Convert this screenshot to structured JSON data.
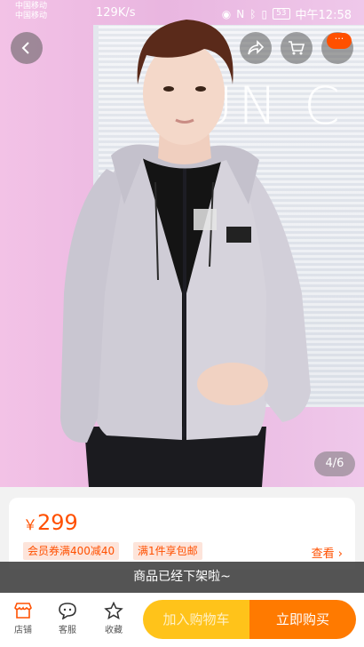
{
  "status_bar": {
    "carrier_1": "中国移动",
    "carrier_2": "中国移动",
    "speed": "129K/s",
    "battery": "53",
    "time": "中午12:58"
  },
  "gallery": {
    "page_indicator": "4/6"
  },
  "product": {
    "currency": "￥",
    "price": "299",
    "coupon_tag": "会员券满400减40",
    "shipping_tag": "满1件享包邮",
    "view_more": "查看"
  },
  "notice": {
    "offline_text": "商品已经下架啦~"
  },
  "bottom_bar": {
    "shop_label": "店铺",
    "service_label": "客服",
    "favorite_label": "收藏",
    "add_to_cart_label": "加入购物车",
    "buy_now_label": "立即购买"
  },
  "more_badge": "···",
  "colors": {
    "accent": "#ff5000",
    "cart_button": "#ffc31a",
    "buy_button": "#ff7a00"
  }
}
